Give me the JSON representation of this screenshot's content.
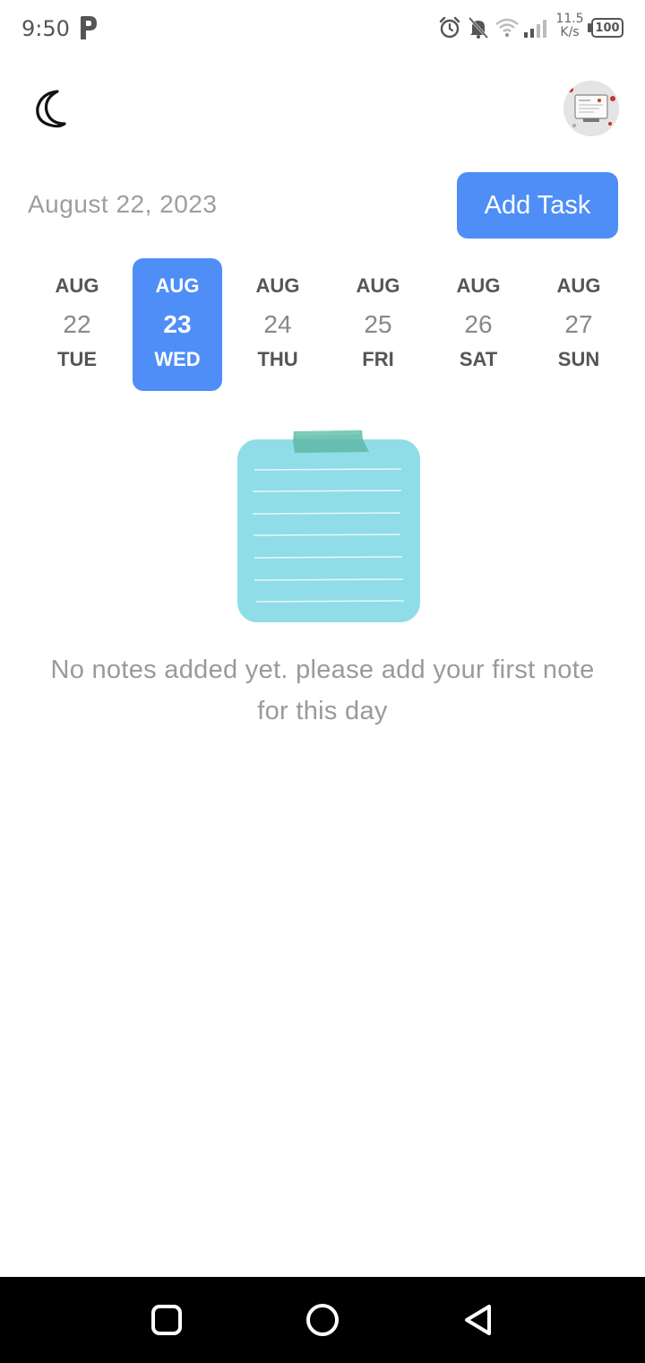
{
  "status_bar": {
    "time": "9:50",
    "net_speed_value": "11.5",
    "net_speed_unit": "K/s",
    "battery": "100"
  },
  "header": {
    "dark_mode_icon": "moon-icon",
    "avatar": "profile-avatar"
  },
  "date_header": {
    "current_date": "August 22, 2023",
    "add_task_label": "Add Task"
  },
  "date_strip": {
    "days": [
      {
        "month": "AUG",
        "day": "22",
        "weekday": "TUE",
        "selected": false
      },
      {
        "month": "AUG",
        "day": "23",
        "weekday": "WED",
        "selected": true
      },
      {
        "month": "AUG",
        "day": "24",
        "weekday": "THU",
        "selected": false
      },
      {
        "month": "AUG",
        "day": "25",
        "weekday": "FRI",
        "selected": false
      },
      {
        "month": "AUG",
        "day": "26",
        "weekday": "SAT",
        "selected": false
      },
      {
        "month": "AUG",
        "day": "27",
        "weekday": "SUN",
        "selected": false
      }
    ]
  },
  "empty_state": {
    "illustration": "notepad-icon",
    "message": "No notes added yet. please add your first note for this day"
  },
  "nav_bar": {
    "recents": "square-icon",
    "home": "circle-icon",
    "back": "triangle-back-icon"
  },
  "colors": {
    "accent": "#4f8ef7",
    "notepad": "#8fdde6",
    "tape": "#6bbfae"
  }
}
